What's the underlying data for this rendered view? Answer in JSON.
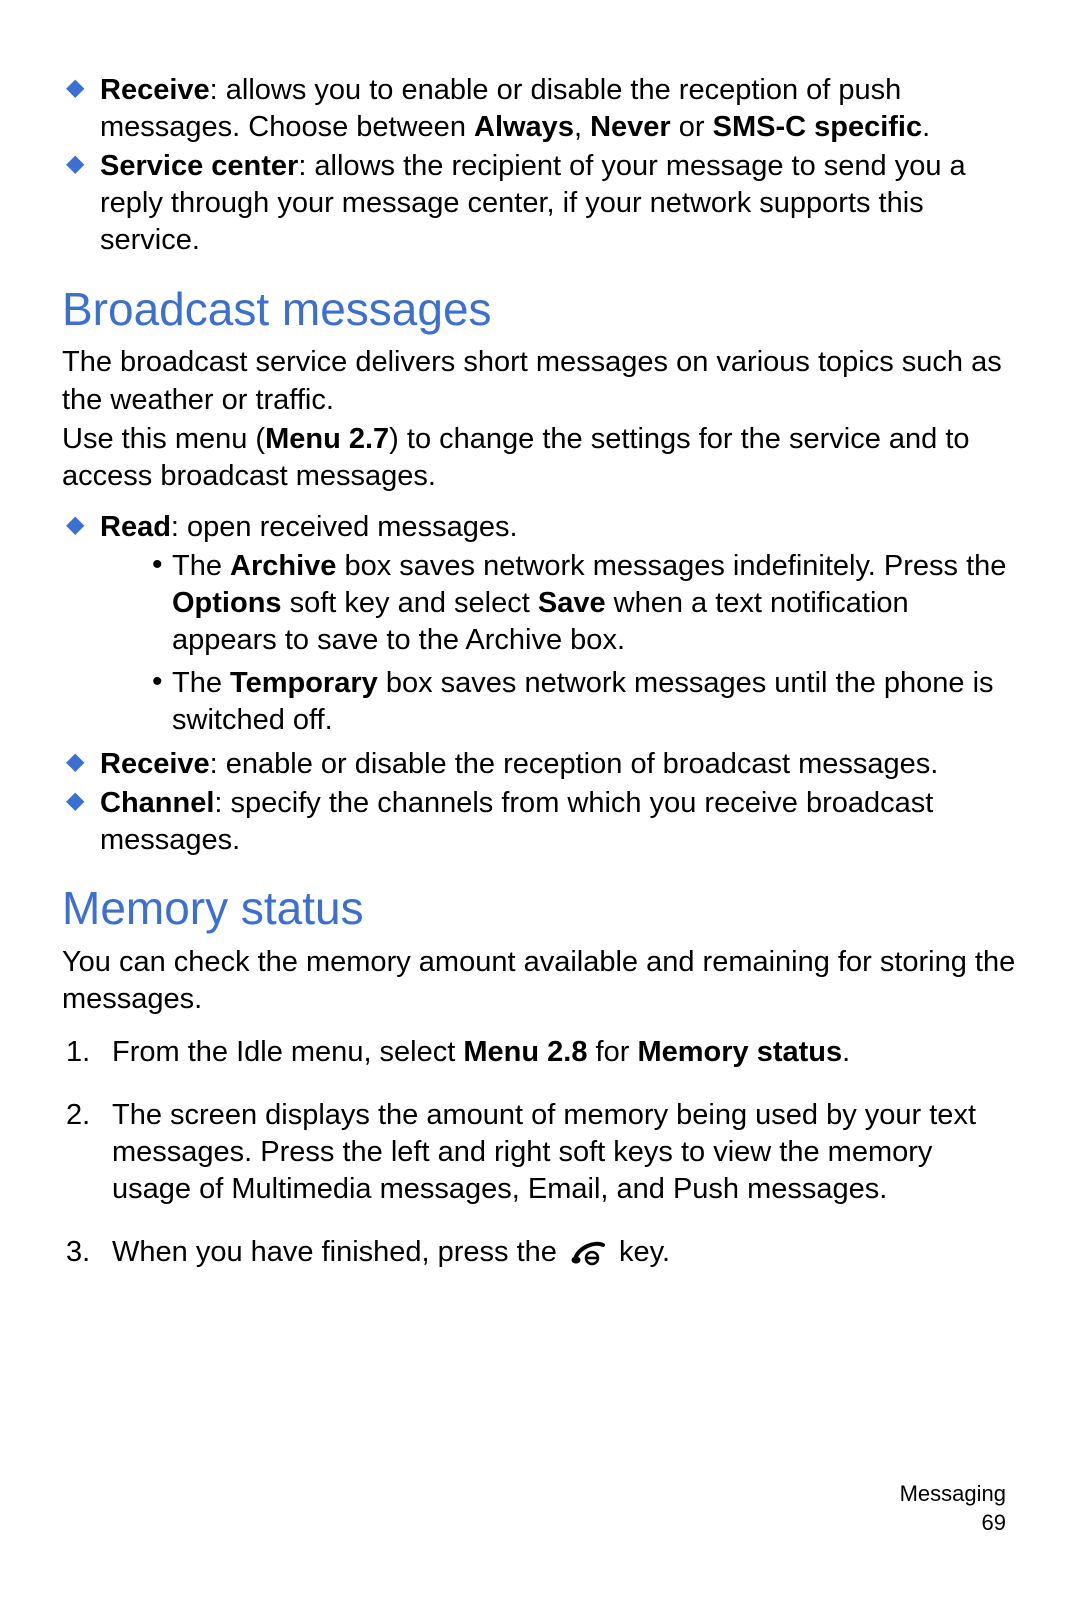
{
  "top_bullets": [
    {
      "term": "Receive",
      "text": ": allows you to enable or disable the reception of push messages. Choose between ",
      "bold_tail": [
        "Always",
        ", ",
        "Never",
        " or ",
        "SMS-C specific",
        "."
      ]
    },
    {
      "term": "Service center",
      "text": ": allows the recipient of your message to send you a reply through your message center, if your network supports this service."
    }
  ],
  "section1": {
    "heading": "Broadcast messages",
    "intro1": "The broadcast service delivers short messages on various topics such as the weather or traffic.",
    "intro2_pre": "Use this menu (",
    "intro2_bold": "Menu 2.7",
    "intro2_post": ") to change the settings for the service and to access broadcast messages.",
    "bullets": [
      {
        "term": "Read",
        "text": ": open received messages.",
        "subs": [
          {
            "pre": "The ",
            "b1": "Archive",
            "mid1": " box saves network messages indefinitely. Press the ",
            "b2": "Options",
            "mid2": " soft key and select ",
            "b3": "Save",
            "post": " when a text notification appears to save to the Archive box."
          },
          {
            "pre": "The ",
            "b1": "Temporary",
            "mid1": " box saves network messages until the phone is switched off.",
            "b2": "",
            "mid2": "",
            "b3": "",
            "post": ""
          }
        ]
      },
      {
        "term": "Receive",
        "text": ": enable or disable the reception of broadcast messages."
      },
      {
        "term": "Channel",
        "text": ": specify the channels from which you receive broadcast messages."
      }
    ]
  },
  "section2": {
    "heading": "Memory status",
    "intro": "You can check the memory amount available and remaining for storing the messages.",
    "steps": [
      {
        "pre": "From the Idle menu, select ",
        "b1": "Menu 2.8",
        "mid": " for ",
        "b2": "Memory status",
        "post": "."
      },
      {
        "pre": "The screen displays the amount of memory being used by your text messages. Press the left and right soft keys to view the memory usage of Multimedia messages, Email, and Push messages.",
        "b1": "",
        "mid": "",
        "b2": "",
        "post": ""
      },
      {
        "pre": "When you have finished, press the ",
        "b1": "",
        "mid": "",
        "b2": "",
        "post": " key.",
        "icon": true
      }
    ]
  },
  "footer": {
    "section_name": "Messaging",
    "page_num": "69"
  }
}
